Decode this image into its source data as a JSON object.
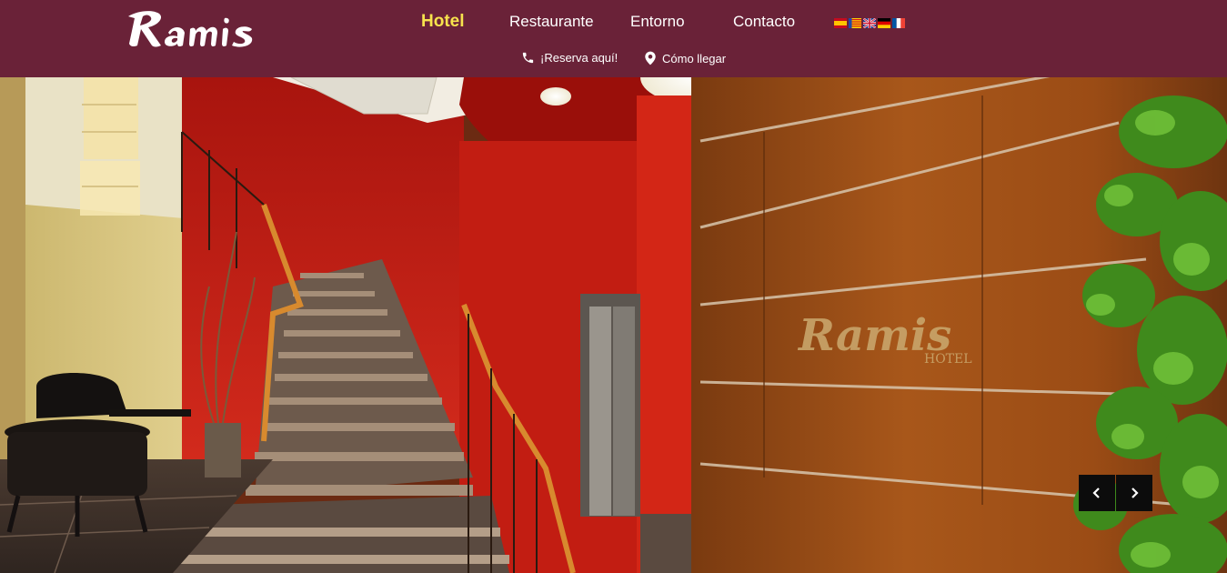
{
  "brand": {
    "name": "Ramis",
    "wall_logo_word": "Ramis",
    "wall_logo_sub": "HOTEL"
  },
  "nav": {
    "items": [
      {
        "label": "Hotel",
        "active": true
      },
      {
        "label": "Restaurante",
        "active": false
      },
      {
        "label": "Entorno",
        "active": false
      },
      {
        "label": "Contacto",
        "active": false
      }
    ]
  },
  "languages": [
    "es",
    "ca-valencia",
    "en",
    "de",
    "fr"
  ],
  "subnav": {
    "reserve_label": "¡Reserva aquí!",
    "reserve_icon": "phone-icon",
    "directions_label": "Cómo llegar",
    "directions_icon": "map-pin-icon"
  },
  "slider": {
    "prev_icon": "chevron-left-icon",
    "next_icon": "chevron-right-icon"
  },
  "colors": {
    "header_bg": "#6a2238",
    "active_nav": "#f7e34d",
    "nav_text": "#ffffff",
    "slider_button_bg": "#0c0c0c"
  }
}
